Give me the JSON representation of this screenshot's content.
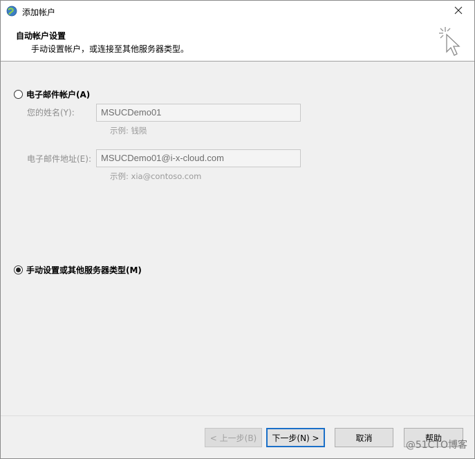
{
  "window": {
    "title": "添加帐户",
    "app_icon": "outlook-globe-icon",
    "close_icon": "close-icon"
  },
  "header": {
    "title": "自动帐户设置",
    "subtitle": "手动设置帐户，或连接至其他服务器类型。",
    "icon": "cursor-click-icon"
  },
  "email_account": {
    "option_label": "电子邮件帐户(A)",
    "selected": false,
    "name_label": "您的姓名(Y):",
    "name_value": "MSUCDemo01",
    "name_example": "示例: 钱陨",
    "email_label": "电子邮件地址(E):",
    "email_value": "MSUCDemo01@i-x-cloud.com",
    "email_example": "示例: xia@contoso.com"
  },
  "manual_setup": {
    "option_label": "手动设置或其他服务器类型(M)",
    "selected": true
  },
  "footer": {
    "back_label": "< 上一步(B)",
    "next_label": "下一步(N) >",
    "cancel_label": "取消",
    "help_label": "帮助"
  },
  "watermark": {
    "text": "@51CTO博客"
  }
}
